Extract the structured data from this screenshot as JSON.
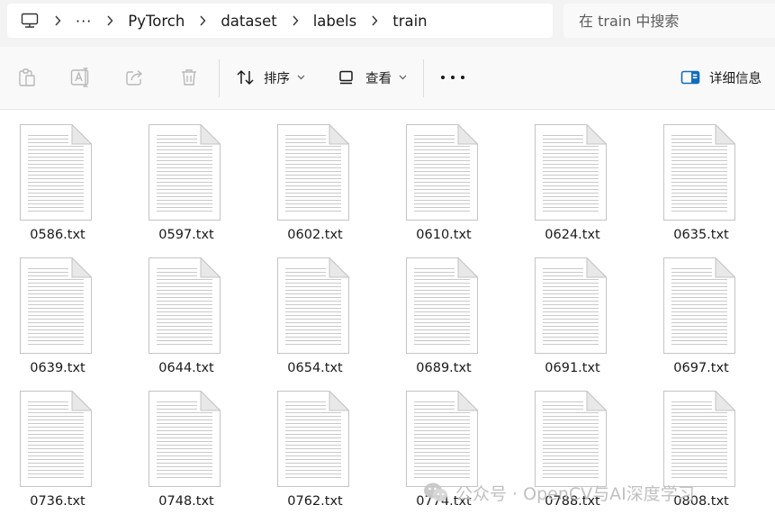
{
  "breadcrumb": {
    "overflow": "···",
    "items": [
      "PyTorch",
      "dataset",
      "labels",
      "train"
    ]
  },
  "search": {
    "placeholder": "在 train 中搜索"
  },
  "toolbar": {
    "icons": [
      "clipboard-icon",
      "rename-icon",
      "share-icon",
      "delete-icon"
    ],
    "sort_label": "排序",
    "view_label": "查看",
    "details_label": "详细信息"
  },
  "files": [
    "0586.txt",
    "0597.txt",
    "0602.txt",
    "0610.txt",
    "0624.txt",
    "0635.txt",
    "0639.txt",
    "0644.txt",
    "0654.txt",
    "0689.txt",
    "0691.txt",
    "0697.txt",
    "0736.txt",
    "0748.txt",
    "0762.txt",
    "0774.txt",
    "0788.txt",
    "0808.txt"
  ],
  "watermark": "公众号 · OpenCV与AI深度学习"
}
